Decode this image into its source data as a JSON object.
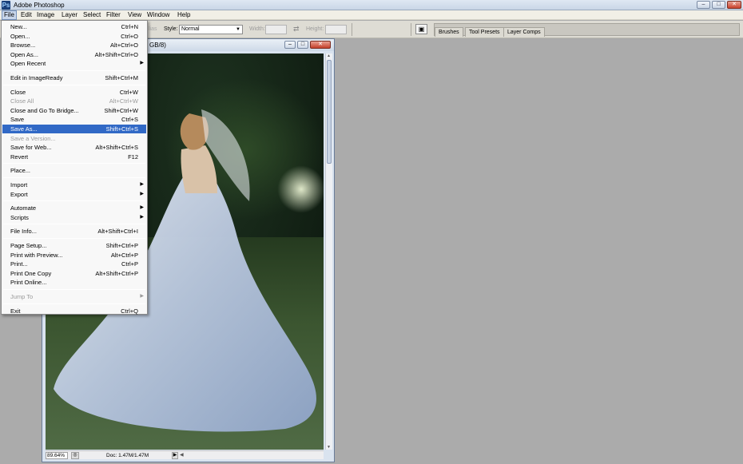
{
  "app": {
    "title": "Adobe Photoshop",
    "icon_glyph": "Ps",
    "window_controls": {
      "minimize": "–",
      "maximize": "□",
      "close": "✕"
    }
  },
  "menubar": {
    "items": [
      "File",
      "Edit",
      "Image",
      "Layer",
      "Select",
      "Filter",
      "View",
      "Window",
      "Help"
    ]
  },
  "options_bar": {
    "feather_fragment": "lias",
    "style_label": "Style:",
    "style_value": "Normal",
    "width_label": "Width:",
    "height_label": "Height:",
    "swap_icon_glyph": "⇄",
    "palette_icon_glyph": "▣",
    "palette_tabs": [
      "Brushes",
      "Tool Presets",
      "Layer Comps"
    ]
  },
  "document": {
    "title_fragment": "GB/8)",
    "zoom": "89.64%",
    "doc_size": "Doc: 1.47M/1.47M",
    "controls": {
      "minimize": "–",
      "maximize": "□",
      "close": "✕"
    }
  },
  "file_menu": {
    "items": [
      {
        "label": "New...",
        "shortcut": "Ctrl+N"
      },
      {
        "label": "Open...",
        "shortcut": "Ctrl+O"
      },
      {
        "label": "Browse...",
        "shortcut": "Alt+Ctrl+O"
      },
      {
        "label": "Open As...",
        "shortcut": "Alt+Shift+Ctrl+O"
      },
      {
        "label": "Open Recent",
        "shortcut": "",
        "submenu": true
      },
      {
        "separator": true
      },
      {
        "label": "Edit in ImageReady",
        "shortcut": "Shift+Ctrl+M"
      },
      {
        "separator": true
      },
      {
        "label": "Close",
        "shortcut": "Ctrl+W"
      },
      {
        "label": "Close All",
        "shortcut": "Alt+Ctrl+W",
        "disabled": true
      },
      {
        "label": "Close and Go To Bridge...",
        "shortcut": "Shift+Ctrl+W"
      },
      {
        "label": "Save",
        "shortcut": "Ctrl+S"
      },
      {
        "label": "Save As...",
        "shortcut": "Shift+Ctrl+S",
        "highlight": true
      },
      {
        "label": "Save a Version...",
        "shortcut": "",
        "disabled": true
      },
      {
        "label": "Save for Web...",
        "shortcut": "Alt+Shift+Ctrl+S"
      },
      {
        "label": "Revert",
        "shortcut": "F12"
      },
      {
        "separator": true
      },
      {
        "label": "Place...",
        "shortcut": ""
      },
      {
        "separator": true
      },
      {
        "label": "Import",
        "shortcut": "",
        "submenu": true
      },
      {
        "label": "Export",
        "shortcut": "",
        "submenu": true
      },
      {
        "separator": true
      },
      {
        "label": "Automate",
        "shortcut": "",
        "submenu": true
      },
      {
        "label": "Scripts",
        "shortcut": "",
        "submenu": true
      },
      {
        "separator": true
      },
      {
        "label": "File Info...",
        "shortcut": "Alt+Shift+Ctrl+I"
      },
      {
        "separator": true
      },
      {
        "label": "Page Setup...",
        "shortcut": "Shift+Ctrl+P"
      },
      {
        "label": "Print with Preview...",
        "shortcut": "Alt+Ctrl+P"
      },
      {
        "label": "Print...",
        "shortcut": "Ctrl+P"
      },
      {
        "label": "Print One Copy",
        "shortcut": "Alt+Shift+Ctrl+P"
      },
      {
        "label": "Print Online...",
        "shortcut": ""
      },
      {
        "separator": true
      },
      {
        "label": "Jump To",
        "shortcut": "",
        "submenu": true,
        "disabled": true
      },
      {
        "separator": true
      },
      {
        "label": "Exit",
        "shortcut": "Ctrl+Q"
      }
    ]
  },
  "colors": {
    "workspace": "#ababab",
    "menu_highlight": "#3169c6",
    "close_button": "#c9422d"
  }
}
